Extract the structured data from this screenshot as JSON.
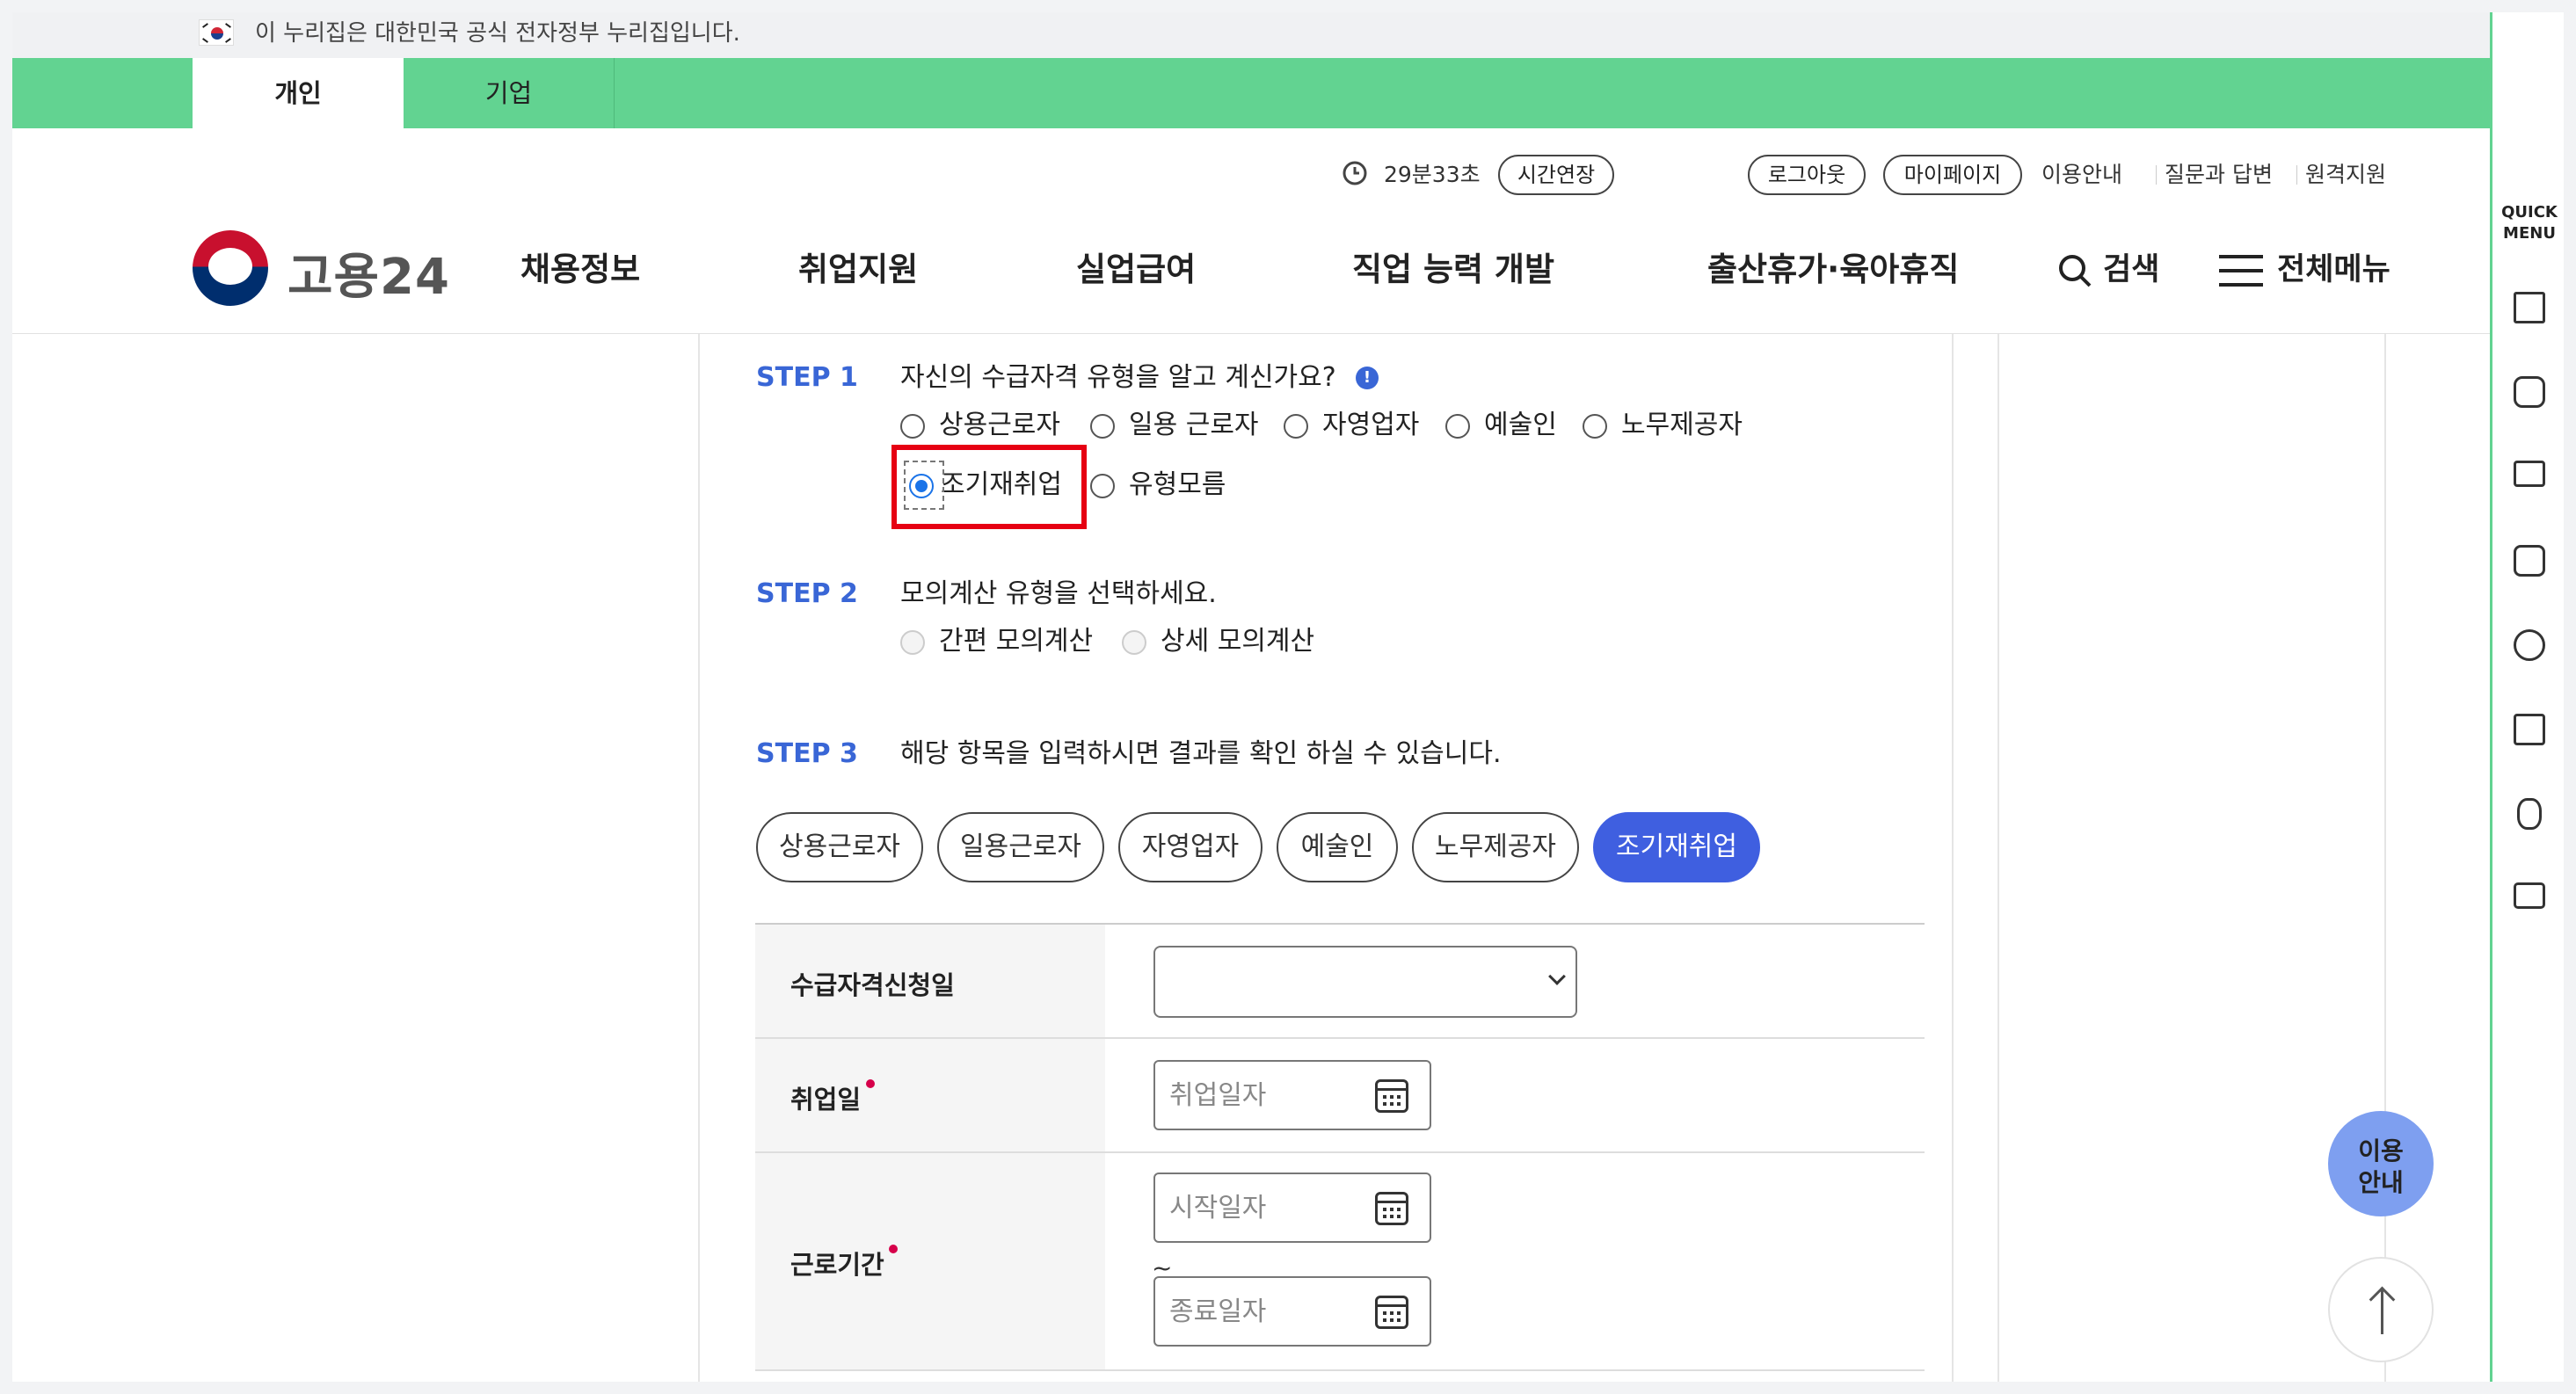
{
  "gov_banner": {
    "text": "이 누리집은 대한민국 공식 전자정부 누리집입니다."
  },
  "top_tabs": {
    "personal": "개인",
    "business": "기업"
  },
  "utility": {
    "timer": "29분33초",
    "extend": "시간연장",
    "logout": "로그아웃",
    "mypage": "마이페이지",
    "guide": "이용안내",
    "qna": "질문과 답변",
    "remote": "원격지원"
  },
  "logo": {
    "text": "고용24"
  },
  "nav": {
    "items": [
      "채용정보",
      "취업지원",
      "실업급여",
      "직업 능력 개발",
      "출산휴가·육아휴직"
    ],
    "search": "검색",
    "all_menu": "전체메뉴"
  },
  "step1": {
    "label": "STEP 1",
    "question": "자신의 수급자격 유형을 알고 계신가요?",
    "options": [
      "상용근로자",
      "일용 근로자",
      "자영업자",
      "예술인",
      "노무제공자",
      "조기재취업",
      "유형모름"
    ],
    "selected": "조기재취업"
  },
  "step2": {
    "label": "STEP 2",
    "question": "모의계산 유형을 선택하세요.",
    "options": [
      "간편 모의계산",
      "상세 모의계산"
    ]
  },
  "step3": {
    "label": "STEP 3",
    "question": "해당 항목을 입력하시면 결과를 확인 하실 수 있습니다.",
    "types": [
      "상용근로자",
      "일용근로자",
      "자영업자",
      "예술인",
      "노무제공자",
      "조기재취업"
    ],
    "active_type": "조기재취업"
  },
  "form": {
    "apply_date_label": "수급자격신청일",
    "apply_date_value": "",
    "employment_date_label": "취업일",
    "employment_date_placeholder": "취업일자",
    "work_period_label": "근로기간",
    "start_placeholder": "시작일자",
    "end_placeholder": "종료일자",
    "tilde": "~"
  },
  "quick_menu": {
    "title": "QUICK\nMENU",
    "icons": [
      "building-icon",
      "chat-icon",
      "monitor-icon",
      "checklist-icon",
      "smile-icon",
      "calculator-icon",
      "coin-icon",
      "printer-icon"
    ]
  },
  "floating": {
    "guide": "이용\n안내"
  },
  "colors": {
    "green": "#62d391",
    "step_blue": "#3966d6",
    "active_blue": "#3f5fe0",
    "highlight_red": "#e60012"
  }
}
